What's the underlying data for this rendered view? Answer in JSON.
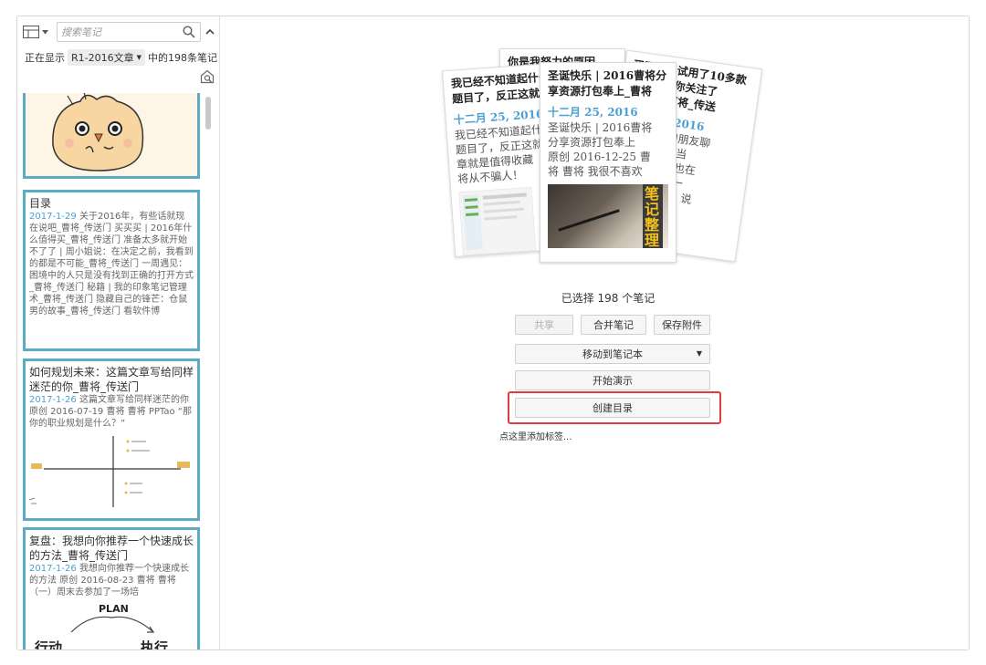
{
  "search": {
    "placeholder": "搜索笔记"
  },
  "status": {
    "prefix": "正在显示",
    "notebook": "R1-2016文章",
    "suffix": "中的198条笔记"
  },
  "notes": [
    {
      "title": "目录",
      "date": "2017-1-29",
      "snippet": "关于2016年，有些话就现在说吧_曹将_传送门 买买买 | 2016年什么值得买_曹将_传送门 准备太多就开始不了了 | 周小姐说：在决定之前，我看到的都是不可能_曹将_传送门 一周遇见：困境中的人只是没有找到正确的打开方式_曹将_传送门 秘籍 | 我的印象笔记管理术_曹将_传送门 隐藏自己的锋芒：仓鼠男的故事_曹将_传送门 看软件博"
    },
    {
      "title": "如何规划未来：这篇文章写给同样迷茫的你_曹将_传送门",
      "date": "2017-1-26",
      "snippet": "这篇文章写给同样迷茫的你 原创 2016-07-19 曹将 曹将 PPTao “那你的职业规划是什么？”"
    },
    {
      "title": "复盘：我想向你推荐一个快速成长的方法_曹将_传送门",
      "date": "2017-1-26",
      "snippet": "我想向你推荐一个快速成长的方法 原创 2016-08-23 曹将 曹将 （一）周末去参加了一场培"
    }
  ],
  "thumb_labels": {
    "sketch_word_left": "行动",
    "sketch_word_right": "执行",
    "sketch_word_top": "PLAN"
  },
  "stack": {
    "back_card": {
      "title": "你是我努力的原因"
    },
    "right_card": {
      "title_line1": "买买买 | 试用了10多款",
      "title_line2": "好意思，你关注了",
      "title_line3": "个笨蛋_曹将_传送",
      "date": "二月 25, 2016",
      "body": [
        "几天突然和朋友聊",
        "三。我说，当",
        "己大年三十也在",
        "里自习。他一",
        "呀地看着我，说",
        "不校太残忍。",
        "不是这样的，",
        "己跟老师要到"
      ]
    },
    "left_card": {
      "title_line1": "我已经不知道起什么",
      "title_line2": "题目了，反正这就",
      "date": "十二月 25, 2016",
      "body": [
        "我已经不知道起什么",
        "题目了，反正这就",
        "章就是值得收藏",
        "将从不骗人！"
      ]
    },
    "front_card": {
      "title_line1": "圣诞快乐 | 2016曹将分",
      "title_line2": "享资源打包奉上_曹将",
      "date": "十二月 25, 2016",
      "body": [
        "圣诞快乐 | 2016曹将",
        "分享资源打包奉上",
        "原创 2016-12-25 曹",
        "将 曹将 我很不喜欢"
      ],
      "image_text": "笔记整理术"
    }
  },
  "selection": {
    "label": "已选择 198 个笔记"
  },
  "actions": {
    "share": "共享",
    "merge": "合并笔记",
    "save_attachments": "保存附件",
    "move_to_notebook": "移动到笔记本",
    "start_presentation": "开始演示",
    "create_toc": "创建目录",
    "add_tag": "点这里添加标签..."
  },
  "colors": {
    "card_border": "#5bacc4",
    "date_blue": "#4aa0d2",
    "highlight_red": "#e13b3b"
  }
}
